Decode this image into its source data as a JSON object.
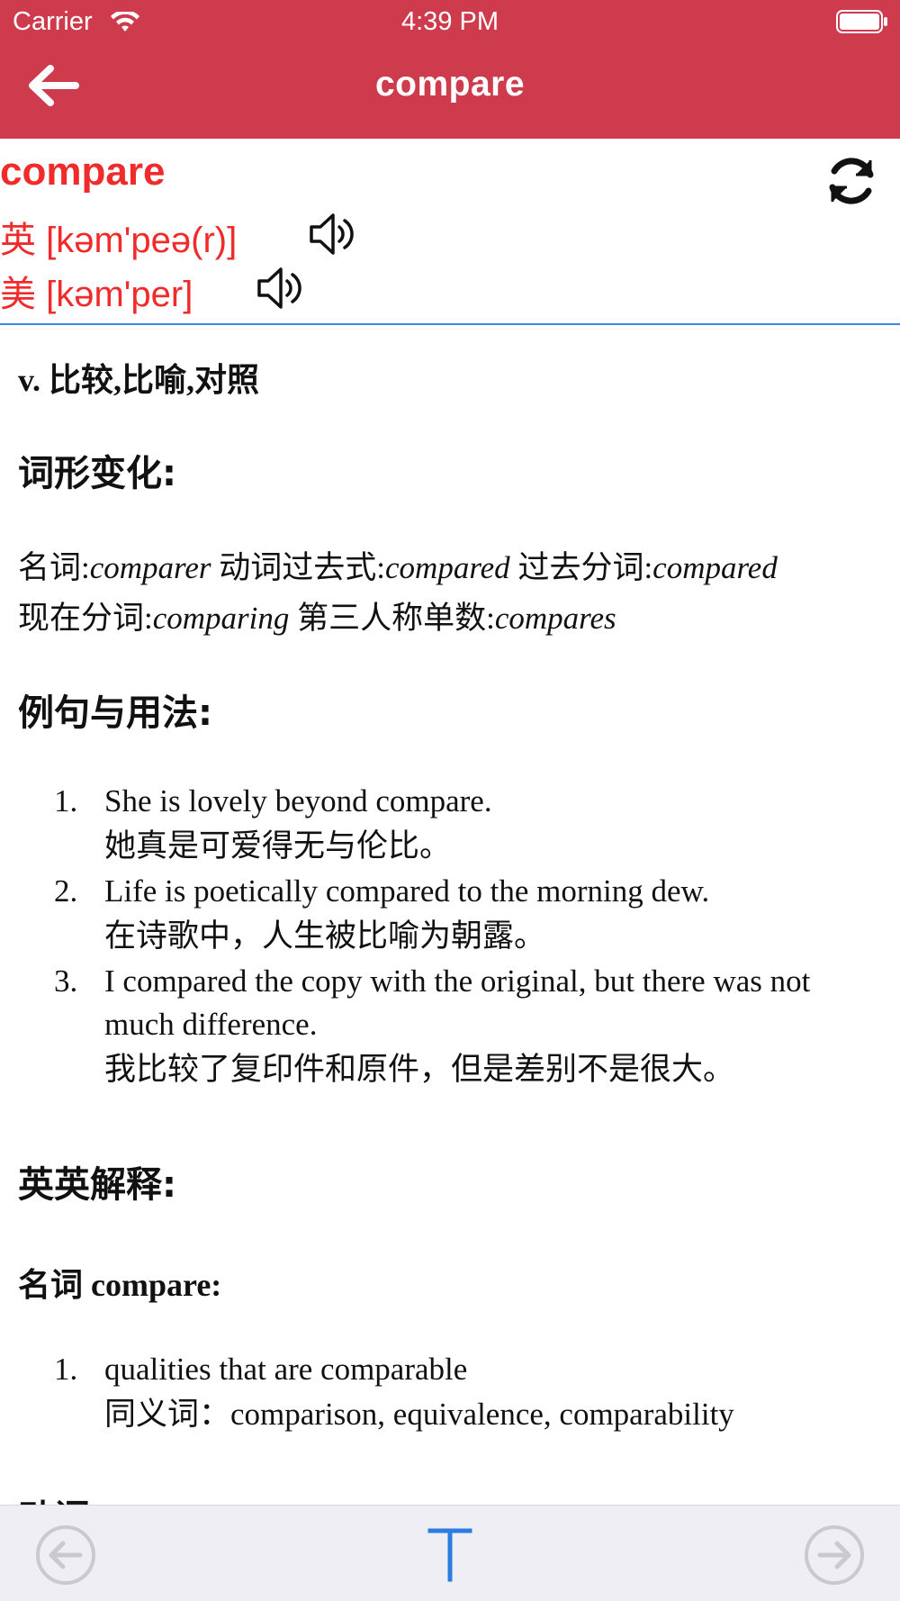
{
  "status_bar": {
    "carrier": "Carrier",
    "time": "4:39 PM"
  },
  "nav": {
    "title": "compare",
    "back_icon": "arrow-left-icon"
  },
  "word": {
    "headword": "compare",
    "uk_pron": "英 [kəm'peə(r)]",
    "us_pron": "美 [kəm'per]",
    "refresh_icon": "refresh-icon",
    "speaker_icon": "speaker-icon"
  },
  "content": {
    "definition": "v. 比较,比喻,对照",
    "forms_heading": "词形变化:",
    "forms": [
      {
        "label": "名词:",
        "value": "comparer"
      },
      {
        "label": "动词过去式:",
        "value": "compared"
      },
      {
        "label": "过去分词:",
        "value": "compared"
      },
      {
        "label": "现在分词:",
        "value": "comparing"
      },
      {
        "label": "第三人称单数:",
        "value": "compares"
      }
    ],
    "examples_heading": "例句与用法:",
    "examples": [
      {
        "num": "1.",
        "en": "She is lovely beyond compare.",
        "cn": "她真是可爱得无与伦比。"
      },
      {
        "num": "2.",
        "en": "Life is poetically compared to the morning dew.",
        "cn": "在诗歌中，人生被比喻为朝露。"
      },
      {
        "num": "3.",
        "en": "I compared the copy with the original, but there was not much difference.",
        "cn": "我比较了复印件和原件，但是差别不是很大。"
      }
    ],
    "eng_heading": "英英解释:",
    "noun_heading": "名词 compare:",
    "noun_defs": [
      {
        "num": "1.",
        "en": "qualities that are comparable",
        "syn": "同义词：comparison, equivalence, comparability"
      }
    ],
    "next_heading_peek": "动词"
  },
  "toolbar": {
    "prev_icon": "circle-arrow-left-icon",
    "font_icon": "text-size-icon",
    "font_label": "T",
    "next_icon": "circle-arrow-right-icon"
  },
  "colors": {
    "nav_bg": "#cd3b4d",
    "accent_red": "#ef2b2b",
    "divider_blue": "#3a86f0",
    "toolbar_blue": "#2a7de1"
  }
}
